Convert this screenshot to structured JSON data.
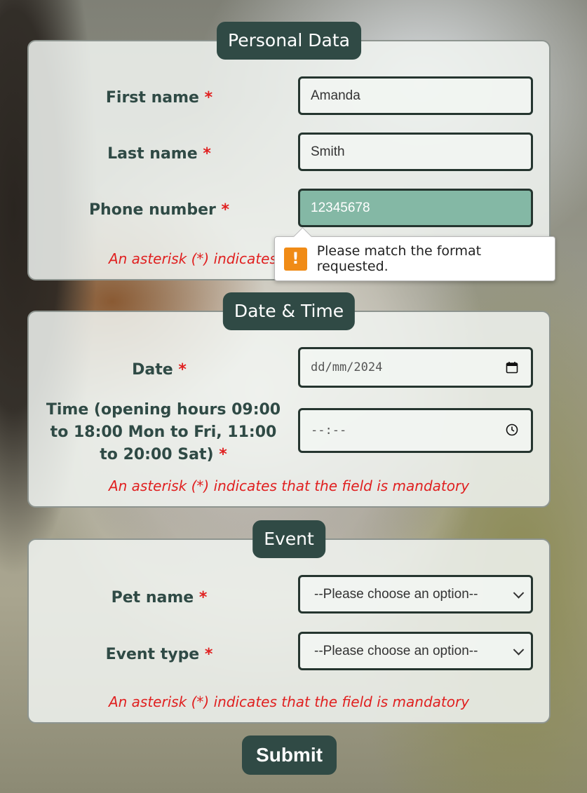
{
  "personal": {
    "legend": "Personal Data",
    "first_name_label": "First name",
    "first_name_value": "Amanda",
    "last_name_label": "Last name",
    "last_name_value": "Smith",
    "phone_label": "Phone number",
    "phone_value": "12345678",
    "note": "An asterisk (*) indicates that the field is mandatory"
  },
  "validation": {
    "message": "Please match the format requested."
  },
  "datetime": {
    "legend": "Date & Time",
    "date_label": "Date",
    "date_placeholder": "dd/mm/2024",
    "time_label": "Time (opening hours 09:00 to 18:00 Mon to Fri, 11:00 to 20:00 Sat)",
    "time_placeholder": "--:--",
    "note": "An asterisk (*) indicates that the field is mandatory"
  },
  "event": {
    "legend": "Event",
    "pet_label": "Pet name",
    "pet_selected": "--Please choose an option--",
    "type_label": "Event type",
    "type_selected": "--Please choose an option--",
    "note": "An asterisk (*) indicates that the field is mandatory"
  },
  "required_marker": "*",
  "submit_label": "Submit",
  "colors": {
    "legend_bg": "#304a45",
    "label_text": "#2f4a45",
    "required": "#e02020",
    "phone_invalid_bg": "#84b8a5",
    "warning_icon": "#f08b16"
  },
  "icons": {
    "calendar": "calendar-icon",
    "clock": "clock-icon",
    "chevron": "chevron-down-icon",
    "warning": "warning-icon"
  }
}
